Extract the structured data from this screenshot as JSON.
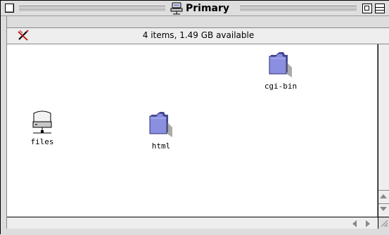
{
  "window": {
    "title": "Primary",
    "title_icon": "file-server-icon"
  },
  "info": {
    "status": "4 items, 1.49 GB available",
    "icon": "pencil-crossed-icon"
  },
  "items": [
    {
      "name": "cgi-bin",
      "type": "folder"
    },
    {
      "name": "files",
      "type": "network-drive"
    },
    {
      "name": "html",
      "type": "folder"
    }
  ],
  "colors": {
    "folder": "#8a8fe0",
    "folder_shadow": "#4a4f9a",
    "chrome": "#dddddd"
  }
}
